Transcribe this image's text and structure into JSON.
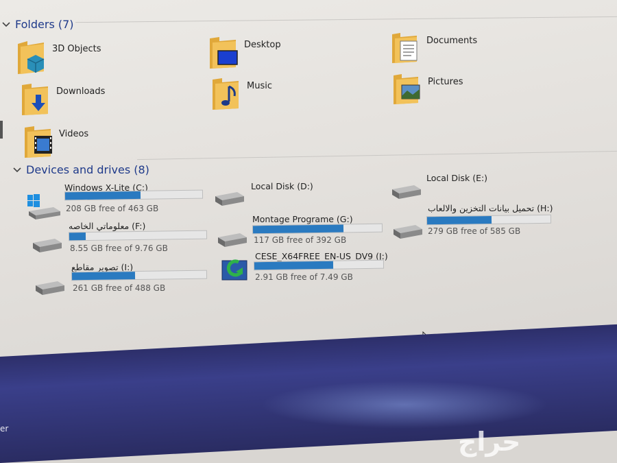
{
  "folders_group": {
    "title": "Folders (7)"
  },
  "folders": [
    {
      "label": "3D Objects",
      "icon": "3d-objects-folder-icon"
    },
    {
      "label": "Desktop",
      "icon": "desktop-folder-icon"
    },
    {
      "label": "Documents",
      "icon": "documents-folder-icon"
    },
    {
      "label": "Downloads",
      "icon": "downloads-folder-icon"
    },
    {
      "label": "Music",
      "icon": "music-folder-icon"
    },
    {
      "label": "Pictures",
      "icon": "pictures-folder-icon"
    },
    {
      "label": "Videos",
      "icon": "videos-folder-icon"
    }
  ],
  "drives_group": {
    "title": "Devices and drives (8)"
  },
  "drives": [
    {
      "name": "Windows X-Lite (C:)",
      "free": "208 GB free of 463 GB",
      "used_fraction": 0.55,
      "has_bar": true,
      "icon": "windows-drive-icon"
    },
    {
      "name": "Local Disk (D:)",
      "free": "",
      "used_fraction": 0,
      "has_bar": false,
      "icon": "hard-drive-icon"
    },
    {
      "name": "Local Disk (E:)",
      "free": "",
      "used_fraction": 0,
      "has_bar": false,
      "icon": "hard-drive-icon"
    },
    {
      "name": "معلوماتي الخاصه (F:)",
      "free": "8.55 GB free of 9.76 GB",
      "used_fraction": 0.12,
      "has_bar": true,
      "icon": "hard-drive-icon"
    },
    {
      "name": "Montage Programe (G:)",
      "free": "117 GB free of 392 GB",
      "used_fraction": 0.7,
      "has_bar": true,
      "icon": "hard-drive-icon"
    },
    {
      "name": "تحميل بيانات التخزين والالعاب (H:)",
      "free": "279 GB free of 585 GB",
      "used_fraction": 0.52,
      "has_bar": true,
      "icon": "hard-drive-icon"
    },
    {
      "name": "تصوير مقاطع (I:)",
      "free": "261 GB free of 488 GB",
      "used_fraction": 0.47,
      "has_bar": true,
      "icon": "hard-drive-icon"
    },
    {
      "name": "CESE_X64FREE_EN-US_DV9 (J:)",
      "free": "2.91 GB free of 7.49 GB",
      "used_fraction": 0.61,
      "has_bar": true,
      "icon": "dvd-drive-icon"
    }
  ],
  "taskbar": {
    "fragment": "er"
  },
  "watermark": {
    "text": "حراج"
  },
  "colors": {
    "accent": "#1f3a8a",
    "bar_fill": "#2a7ac0",
    "folder": "#e0a83a"
  }
}
